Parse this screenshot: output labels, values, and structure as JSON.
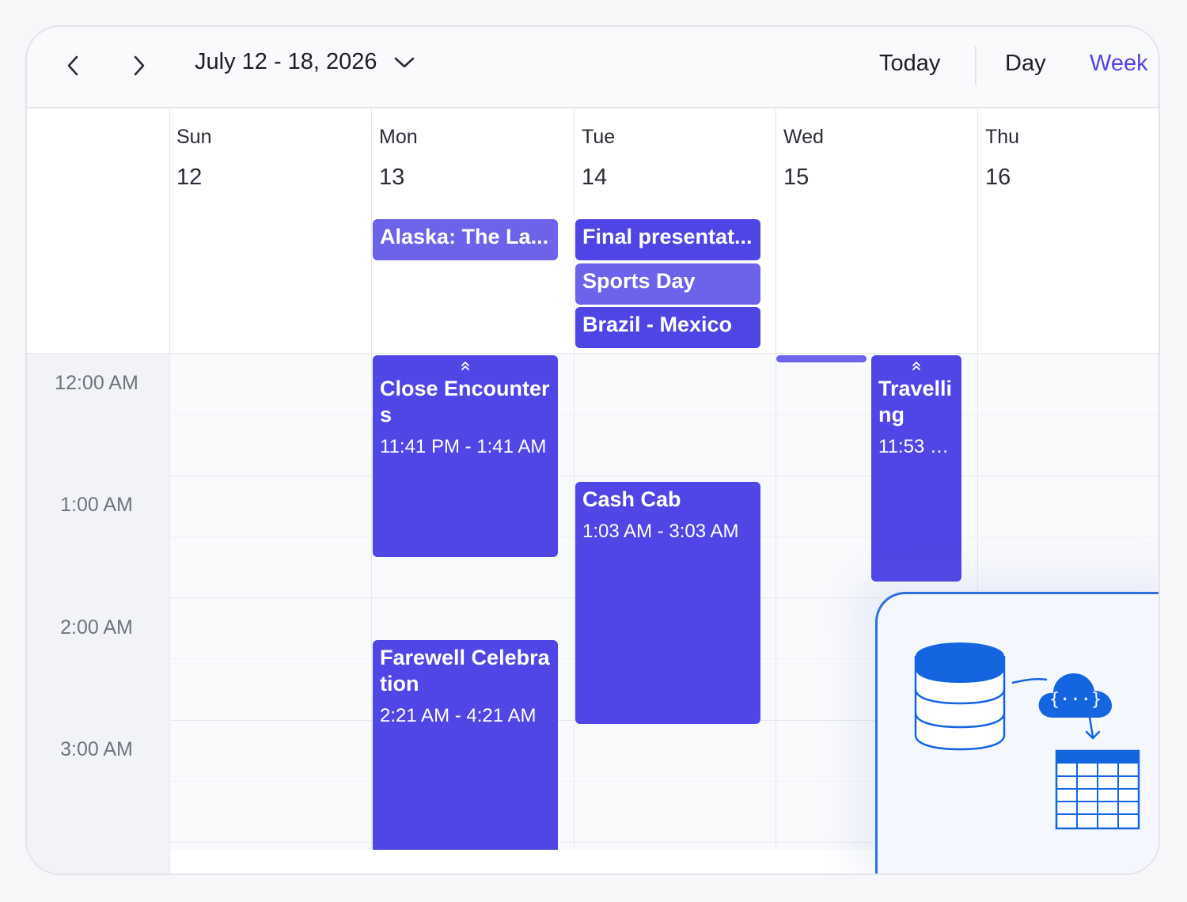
{
  "toolbar": {
    "date_range": "July 12 - 18, 2026",
    "today_label": "Today",
    "day_label": "Day",
    "week_label": "Week",
    "active_view": "Week"
  },
  "days": [
    {
      "name": "Sun",
      "num": "12"
    },
    {
      "name": "Mon",
      "num": "13"
    },
    {
      "name": "Tue",
      "num": "14"
    },
    {
      "name": "Wed",
      "num": "15"
    },
    {
      "name": "Thu",
      "num": "16"
    }
  ],
  "time_labels": [
    "12:00 AM",
    "1:00 AM",
    "2:00 AM",
    "3:00 AM"
  ],
  "all_day_events": [
    {
      "title": "Alaska: The La...",
      "color": "#6d62ea"
    },
    {
      "title": "Final presentat...",
      "color": "#4f45e4"
    },
    {
      "title": "Sports Day",
      "color": "#6d62ea"
    },
    {
      "title": "Brazil - Mexico",
      "color": "#4f45e4"
    }
  ],
  "events": [
    {
      "title": "Close Encounters",
      "time": "11:41 PM - 1:41 AM"
    },
    {
      "title": "Farewell Celebration",
      "time": "2:21 AM - 4:21 AM"
    },
    {
      "title": "Cash Cab",
      "time": "1:03 AM - 3:03 AM"
    },
    {
      "title": "Travelling",
      "time": "11:53 P..."
    }
  ],
  "colors": {
    "event": "#5046e5",
    "event_light": "#6d62ea",
    "accent": "#5046e5",
    "integration_blue": "#1565e0"
  },
  "icons": [
    "chevron-left-icon",
    "chevron-right-icon",
    "chevron-down-icon",
    "chevron-up-double-icon",
    "database-icon",
    "cloud-api-icon",
    "table-icon"
  ]
}
